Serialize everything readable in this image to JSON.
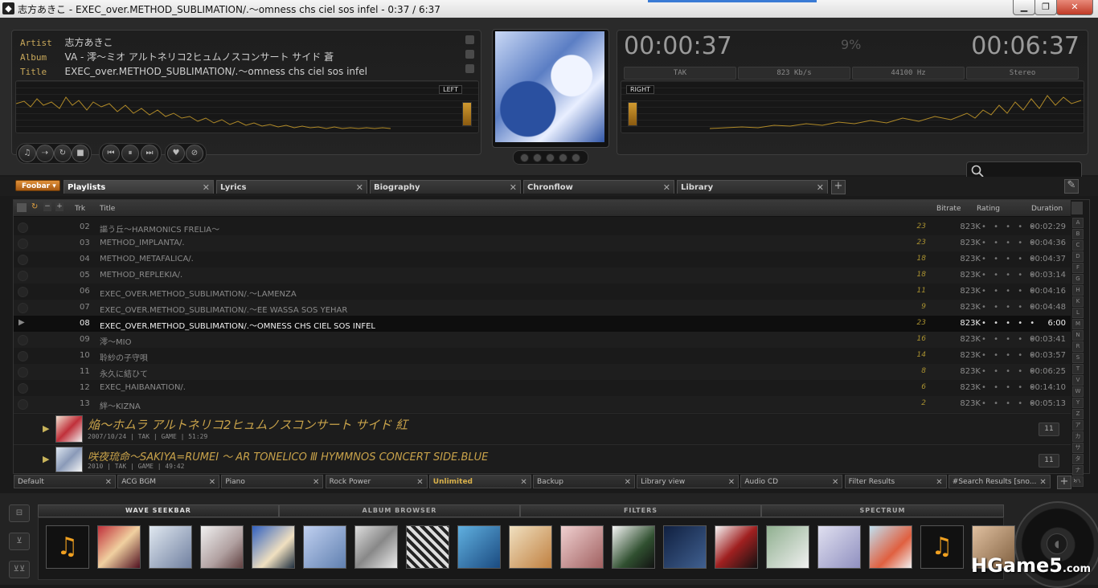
{
  "window": {
    "title": "志方あきこ - EXEC_over.METHOD_SUBLIMATION/.～omness chs ciel sos infel - 0:37 / 6:37",
    "controls": [
      "▁",
      "❐",
      "✕"
    ]
  },
  "now_playing": {
    "artist_label": "Artist",
    "artist": "志方あきこ",
    "album_label": "Album",
    "album": "VA - 澪～ミオ アルトネリコ2ヒュムノスコンサート サイド 蒼",
    "title_label": "Title",
    "title": "EXEC_over.METHOD_SUBLIMATION/.～omness chs ciel sos infel",
    "left_label": "LEFT",
    "right_label": "RIGHT",
    "elapsed": "00:00:37",
    "total": "00:06:37",
    "progress_percent": "9%",
    "codec": "TAK",
    "bitrate": "823 Kb/s",
    "samplerate": "44100 Hz",
    "channels": "Stereo"
  },
  "controls": {
    "icons": [
      "♫",
      "⇢",
      "↻",
      "■",
      "⏮",
      "⏸",
      "⏭",
      "♥",
      "⊘"
    ]
  },
  "tabs": {
    "menu": "Foobar ▾",
    "items": [
      "Playlists",
      "Lyrics",
      "Biography",
      "Chronflow",
      "Library"
    ],
    "active": "Playlists",
    "close": "✕",
    "add": "+"
  },
  "playlist": {
    "headers": {
      "trk": "Trk",
      "title": "Title",
      "bitrate": "Bitrate",
      "rating": "Rating",
      "duration": "Duration"
    },
    "rows": [
      {
        "trk": "02",
        "title": "謳う丘～HARMONICS FRELIA～",
        "count": "23",
        "bitrate": "823K",
        "duration": "00:02:29"
      },
      {
        "trk": "03",
        "title": "METHOD_IMPLANTA/.",
        "count": "23",
        "bitrate": "823K",
        "duration": "00:04:36"
      },
      {
        "trk": "04",
        "title": "METHOD_METAFALICA/.",
        "count": "18",
        "bitrate": "823K",
        "duration": "00:04:37"
      },
      {
        "trk": "05",
        "title": "METHOD_REPLEKIA/.",
        "count": "18",
        "bitrate": "823K",
        "duration": "00:03:14"
      },
      {
        "trk": "06",
        "title": "EXEC_OVER.METHOD_SUBLIMATION/.～LAMENZA",
        "count": "11",
        "bitrate": "823K",
        "duration": "00:04:16"
      },
      {
        "trk": "07",
        "title": "EXEC_OVER.METHOD_SUBLIMATION/.～EE WASSA SOS YEHAR",
        "count": "9",
        "bitrate": "823K",
        "duration": "00:04:48"
      },
      {
        "trk": "08",
        "title": "EXEC_OVER.METHOD_SUBLIMATION/.～OMNESS CHS CIEL SOS INFEL",
        "count": "23",
        "bitrate": "823K",
        "duration": "6:00",
        "playing": "▶"
      },
      {
        "trk": "09",
        "title": "澪～MIO",
        "count": "16",
        "bitrate": "823K",
        "duration": "00:03:41"
      },
      {
        "trk": "10",
        "title": "聆紗の子守唄",
        "count": "14",
        "bitrate": "823K",
        "duration": "00:03:57"
      },
      {
        "trk": "11",
        "title": "永久に結ひて",
        "count": "8",
        "bitrate": "823K",
        "duration": "00:06:25"
      },
      {
        "trk": "12",
        "title": "EXEC_HAIBANATION/.",
        "count": "6",
        "bitrate": "823K",
        "duration": "00:14:10"
      },
      {
        "trk": "13",
        "title": "絆～KIZNA",
        "count": "2",
        "bitrate": "823K",
        "duration": "00:05:13"
      }
    ],
    "rating_stars": "• • • • •",
    "groups": [
      {
        "title": "焔～ホムラ アルトネリコ2ヒュムノスコンサート サイド 紅",
        "sub": "2007/10/24 | TAK | GAME | 51:29",
        "count": "11"
      },
      {
        "title": "咲夜琉命～SAKIYA=RUMEI ～ AR TONELICO Ⅲ HYMMNOS CONCERT SIDE.BLUE",
        "sub": "2010 | TAK | GAME | 49:42",
        "count": "11"
      }
    ],
    "alpha_index": [
      "A",
      "B",
      "C",
      "D",
      "F",
      "G",
      "H",
      "K",
      "L",
      "M",
      "N",
      "R",
      "S",
      "T",
      "V",
      "W",
      "Y",
      "Z",
      "ア",
      "カ",
      "サ",
      "タ",
      "ナ",
      "ハ"
    ]
  },
  "playlist_tabs": {
    "items": [
      "Default",
      "ACG BGM",
      "Piano",
      "Rock Power",
      "Unlimited",
      "Backup",
      "Library view",
      "Audio CD",
      "Filter Results",
      "#Search Results [sno..."
    ],
    "active": "Unlimited"
  },
  "bottom": {
    "tabs": [
      "WAVE SEEKBAR",
      "ALBUM BROWSER",
      "FILTERS",
      "SPECTRUM"
    ],
    "side_icons": [
      "⊟",
      "⊻",
      "⊻⊻"
    ]
  },
  "watermark": {
    "main": "HGame5",
    "suffix": ".com"
  },
  "colors": {
    "accent_gold": "#c8a24a",
    "orange_button": "#c8752a",
    "background": "#1a1a1a"
  }
}
